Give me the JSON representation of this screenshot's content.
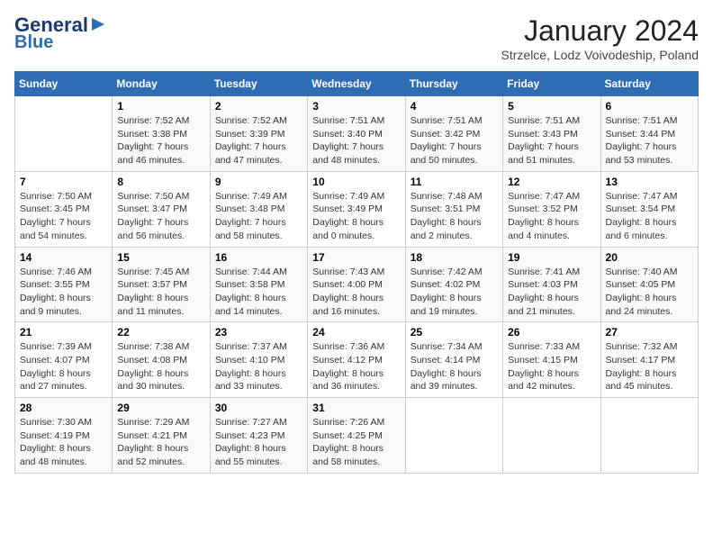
{
  "header": {
    "logo_line1": "General",
    "logo_line2": "Blue",
    "month": "January 2024",
    "location": "Strzelce, Lodz Voivodeship, Poland"
  },
  "weekdays": [
    "Sunday",
    "Monday",
    "Tuesday",
    "Wednesday",
    "Thursday",
    "Friday",
    "Saturday"
  ],
  "weeks": [
    [
      {
        "day": "",
        "info": ""
      },
      {
        "day": "1",
        "info": "Sunrise: 7:52 AM\nSunset: 3:38 PM\nDaylight: 7 hours\nand 46 minutes."
      },
      {
        "day": "2",
        "info": "Sunrise: 7:52 AM\nSunset: 3:39 PM\nDaylight: 7 hours\nand 47 minutes."
      },
      {
        "day": "3",
        "info": "Sunrise: 7:51 AM\nSunset: 3:40 PM\nDaylight: 7 hours\nand 48 minutes."
      },
      {
        "day": "4",
        "info": "Sunrise: 7:51 AM\nSunset: 3:42 PM\nDaylight: 7 hours\nand 50 minutes."
      },
      {
        "day": "5",
        "info": "Sunrise: 7:51 AM\nSunset: 3:43 PM\nDaylight: 7 hours\nand 51 minutes."
      },
      {
        "day": "6",
        "info": "Sunrise: 7:51 AM\nSunset: 3:44 PM\nDaylight: 7 hours\nand 53 minutes."
      }
    ],
    [
      {
        "day": "7",
        "info": "Sunrise: 7:50 AM\nSunset: 3:45 PM\nDaylight: 7 hours\nand 54 minutes."
      },
      {
        "day": "8",
        "info": "Sunrise: 7:50 AM\nSunset: 3:47 PM\nDaylight: 7 hours\nand 56 minutes."
      },
      {
        "day": "9",
        "info": "Sunrise: 7:49 AM\nSunset: 3:48 PM\nDaylight: 7 hours\nand 58 minutes."
      },
      {
        "day": "10",
        "info": "Sunrise: 7:49 AM\nSunset: 3:49 PM\nDaylight: 8 hours\nand 0 minutes."
      },
      {
        "day": "11",
        "info": "Sunrise: 7:48 AM\nSunset: 3:51 PM\nDaylight: 8 hours\nand 2 minutes."
      },
      {
        "day": "12",
        "info": "Sunrise: 7:47 AM\nSunset: 3:52 PM\nDaylight: 8 hours\nand 4 minutes."
      },
      {
        "day": "13",
        "info": "Sunrise: 7:47 AM\nSunset: 3:54 PM\nDaylight: 8 hours\nand 6 minutes."
      }
    ],
    [
      {
        "day": "14",
        "info": "Sunrise: 7:46 AM\nSunset: 3:55 PM\nDaylight: 8 hours\nand 9 minutes."
      },
      {
        "day": "15",
        "info": "Sunrise: 7:45 AM\nSunset: 3:57 PM\nDaylight: 8 hours\nand 11 minutes."
      },
      {
        "day": "16",
        "info": "Sunrise: 7:44 AM\nSunset: 3:58 PM\nDaylight: 8 hours\nand 14 minutes."
      },
      {
        "day": "17",
        "info": "Sunrise: 7:43 AM\nSunset: 4:00 PM\nDaylight: 8 hours\nand 16 minutes."
      },
      {
        "day": "18",
        "info": "Sunrise: 7:42 AM\nSunset: 4:02 PM\nDaylight: 8 hours\nand 19 minutes."
      },
      {
        "day": "19",
        "info": "Sunrise: 7:41 AM\nSunset: 4:03 PM\nDaylight: 8 hours\nand 21 minutes."
      },
      {
        "day": "20",
        "info": "Sunrise: 7:40 AM\nSunset: 4:05 PM\nDaylight: 8 hours\nand 24 minutes."
      }
    ],
    [
      {
        "day": "21",
        "info": "Sunrise: 7:39 AM\nSunset: 4:07 PM\nDaylight: 8 hours\nand 27 minutes."
      },
      {
        "day": "22",
        "info": "Sunrise: 7:38 AM\nSunset: 4:08 PM\nDaylight: 8 hours\nand 30 minutes."
      },
      {
        "day": "23",
        "info": "Sunrise: 7:37 AM\nSunset: 4:10 PM\nDaylight: 8 hours\nand 33 minutes."
      },
      {
        "day": "24",
        "info": "Sunrise: 7:36 AM\nSunset: 4:12 PM\nDaylight: 8 hours\nand 36 minutes."
      },
      {
        "day": "25",
        "info": "Sunrise: 7:34 AM\nSunset: 4:14 PM\nDaylight: 8 hours\nand 39 minutes."
      },
      {
        "day": "26",
        "info": "Sunrise: 7:33 AM\nSunset: 4:15 PM\nDaylight: 8 hours\nand 42 minutes."
      },
      {
        "day": "27",
        "info": "Sunrise: 7:32 AM\nSunset: 4:17 PM\nDaylight: 8 hours\nand 45 minutes."
      }
    ],
    [
      {
        "day": "28",
        "info": "Sunrise: 7:30 AM\nSunset: 4:19 PM\nDaylight: 8 hours\nand 48 minutes."
      },
      {
        "day": "29",
        "info": "Sunrise: 7:29 AM\nSunset: 4:21 PM\nDaylight: 8 hours\nand 52 minutes."
      },
      {
        "day": "30",
        "info": "Sunrise: 7:27 AM\nSunset: 4:23 PM\nDaylight: 8 hours\nand 55 minutes."
      },
      {
        "day": "31",
        "info": "Sunrise: 7:26 AM\nSunset: 4:25 PM\nDaylight: 8 hours\nand 58 minutes."
      },
      {
        "day": "",
        "info": ""
      },
      {
        "day": "",
        "info": ""
      },
      {
        "day": "",
        "info": ""
      }
    ]
  ]
}
